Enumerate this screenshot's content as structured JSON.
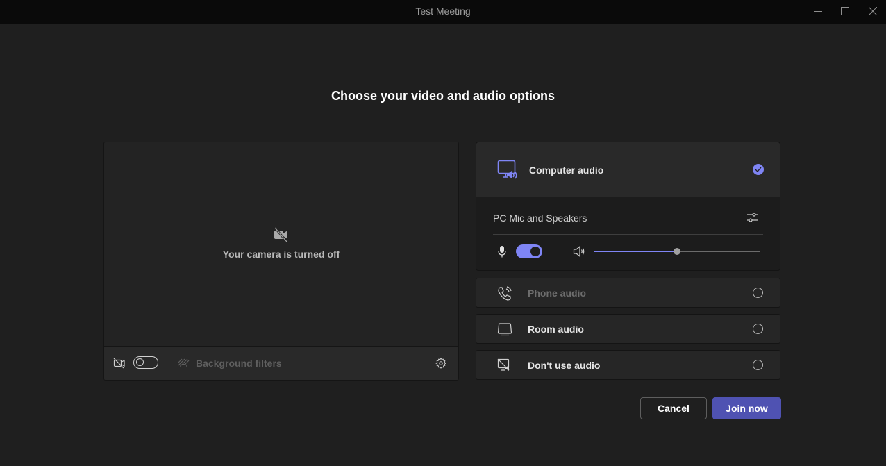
{
  "window": {
    "title": "Test Meeting",
    "controls": [
      "minimize",
      "maximize",
      "close"
    ]
  },
  "heading": "Choose your video and audio options",
  "camera": {
    "status_text": "Your camera is turned off",
    "camera_enabled": false,
    "background_filters_label": "Background filters",
    "icons": {
      "preview": "camera-off-icon",
      "toggle": "camera-off-icon",
      "filters": "background-blur-icon",
      "settings": "gear-icon"
    }
  },
  "audio": {
    "accent_color": "#7f85f5",
    "selected_option": "computer",
    "computer": {
      "label": "Computer audio",
      "icon": "computer-speaker-icon",
      "device_label": "PC Mic and Speakers",
      "mic_enabled": true,
      "speaker_volume_percent": 50
    },
    "options": [
      {
        "id": "phone",
        "label": "Phone audio",
        "icon": "phone-icon",
        "disabled": true
      },
      {
        "id": "room",
        "label": "Room audio",
        "icon": "room-device-icon",
        "disabled": false
      },
      {
        "id": "none",
        "label": "Don't use audio",
        "icon": "no-audio-icon",
        "disabled": false
      }
    ]
  },
  "actions": {
    "cancel_label": "Cancel",
    "join_label": "Join now",
    "join_color": "#4f52b2"
  }
}
